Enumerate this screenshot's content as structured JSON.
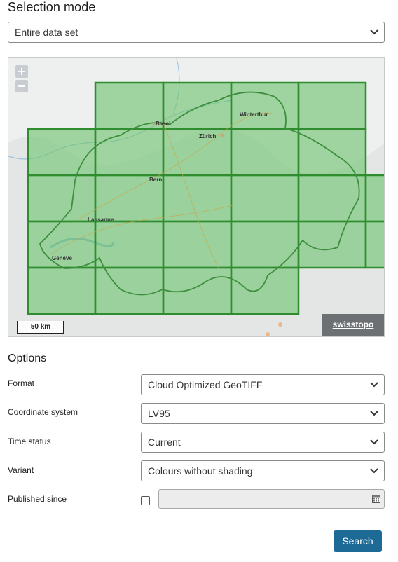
{
  "selection": {
    "title": "Selection mode",
    "mode_value": "Entire data set"
  },
  "map": {
    "zoom_in": "+",
    "zoom_out": "−",
    "scale_label": "50 km",
    "brand_label": "swisstopo",
    "cities": [
      "Basel",
      "Winterthur",
      "Zürich",
      "Bern",
      "Lausanne",
      "Genève"
    ],
    "tile_fill": "#6fc46f",
    "tile_stroke": "#2f8c2f"
  },
  "options": {
    "title": "Options",
    "format": {
      "label": "Format",
      "value": "Cloud Optimized GeoTIFF"
    },
    "coordinate_system": {
      "label": "Coordinate system",
      "value": "LV95"
    },
    "time_status": {
      "label": "Time status",
      "value": "Current"
    },
    "variant": {
      "label": "Variant",
      "value": "Colours without shading"
    },
    "published_since": {
      "label": "Published since",
      "checked": false,
      "value": ""
    }
  },
  "search": {
    "label": "Search"
  },
  "colors": {
    "button": "#1d6a97"
  }
}
